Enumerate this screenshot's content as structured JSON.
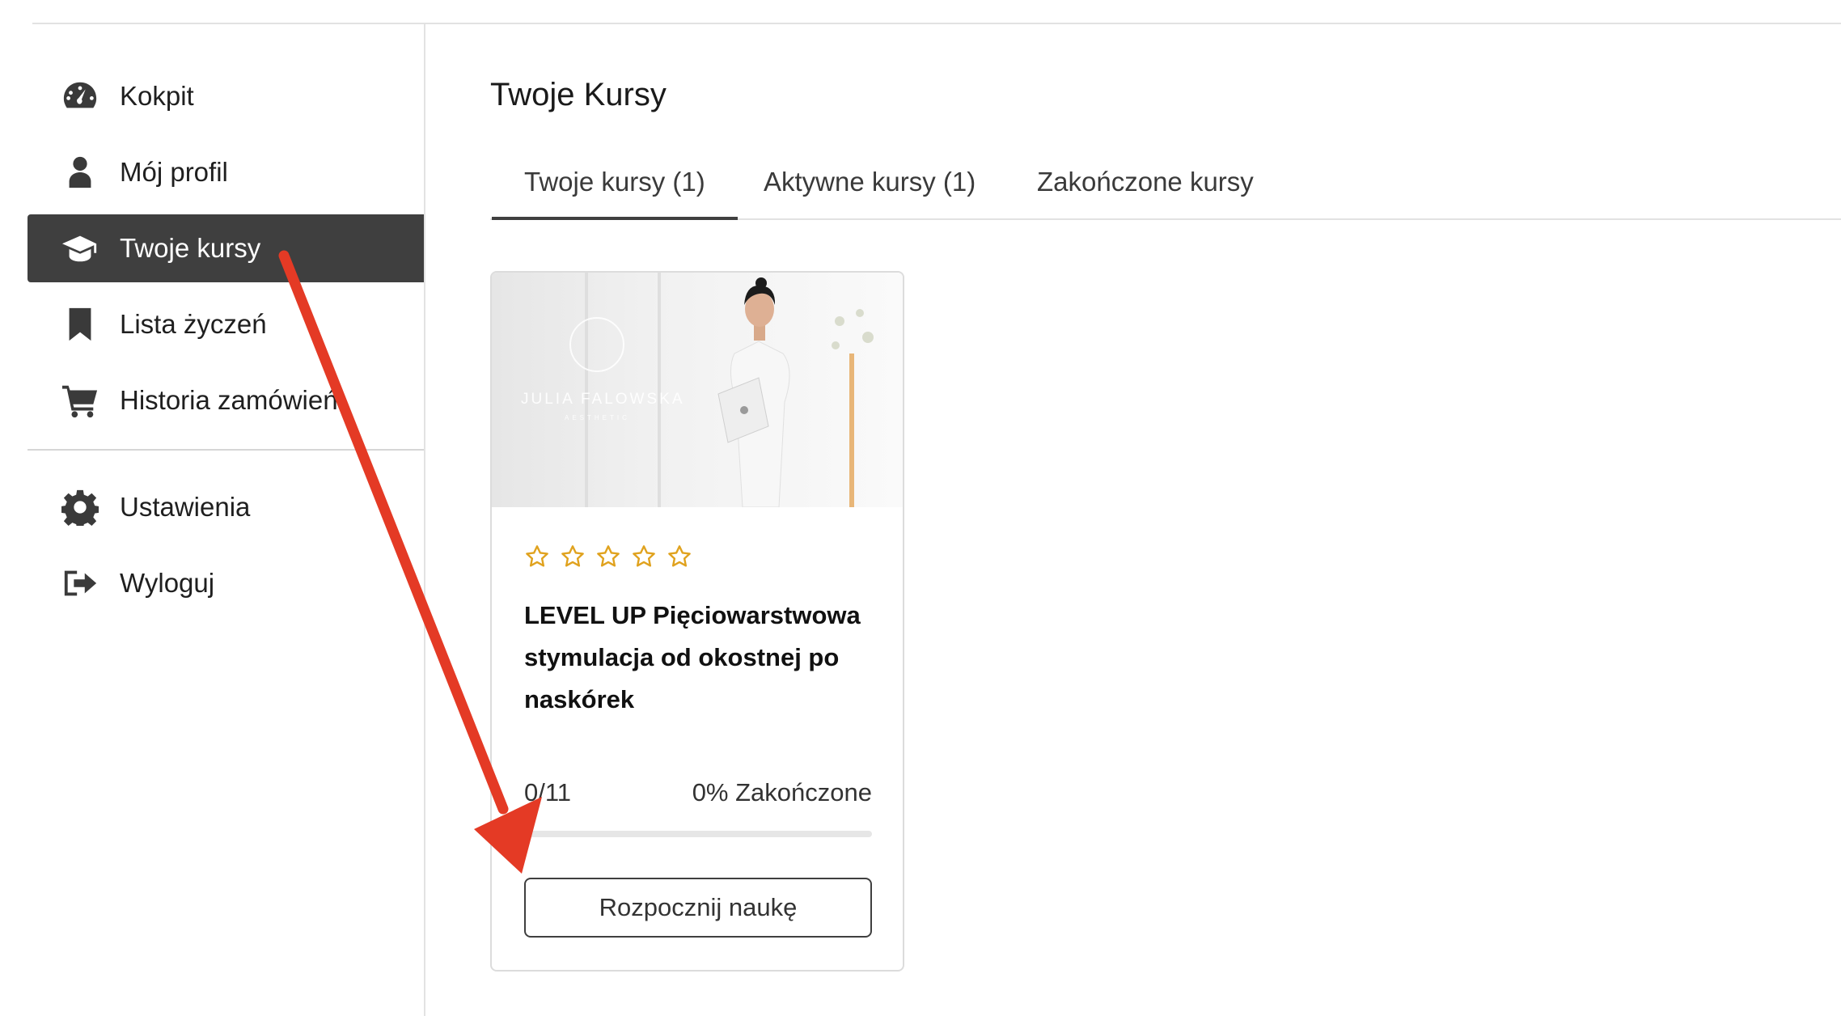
{
  "sidebar": {
    "items": [
      {
        "label": "Kokpit",
        "icon": "dashboard-icon",
        "active": false
      },
      {
        "label": "Mój profil",
        "icon": "user-icon",
        "active": false
      },
      {
        "label": "Twoje kursy",
        "icon": "graduation-cap-icon",
        "active": true
      },
      {
        "label": "Lista życzeń",
        "icon": "bookmark-icon",
        "active": false
      },
      {
        "label": "Historia zamówień",
        "icon": "cart-icon",
        "active": false
      }
    ],
    "bottom_items": [
      {
        "label": "Ustawienia",
        "icon": "gear-icon"
      },
      {
        "label": "Wyloguj",
        "icon": "logout-icon"
      }
    ]
  },
  "main": {
    "title": "Twoje Kursy",
    "tabs": [
      {
        "label": "Twoje kursy (1)",
        "active": true
      },
      {
        "label": "Aktywne kursy (1)",
        "active": false
      },
      {
        "label": "Zakończone kursy",
        "active": false
      }
    ],
    "course": {
      "thumbnail_logo": "JULIA FALOWSKA",
      "thumbnail_logo_sub": "AESTHETIC",
      "rating": 0,
      "rating_max": 5,
      "title": "LEVEL UP Pięciowarstwowa stymulacja od okostnej po naskórek",
      "lessons_progress": "0/11",
      "percent_label": "0% Zakończone",
      "progress_fraction": 0,
      "button_label": "Rozpocznij naukę"
    }
  },
  "colors": {
    "accent_dark": "#3f3f3f",
    "star": "#e0a21e",
    "annotation_arrow": "#e43a25"
  }
}
